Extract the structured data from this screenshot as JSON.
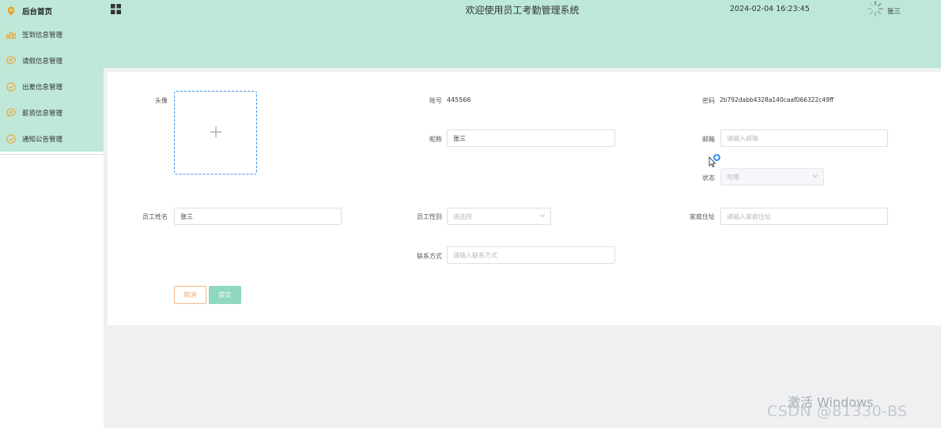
{
  "sidebar": {
    "items": [
      {
        "label": "后台首页",
        "icon": "location-pin-icon"
      },
      {
        "label": "签到信息管理",
        "icon": "bar-chart-icon"
      },
      {
        "label": "请假信息管理",
        "icon": "chat-bubble-icon"
      },
      {
        "label": "出差信息管理",
        "icon": "check-circle-icon"
      },
      {
        "label": "薪资信息管理",
        "icon": "chat-bubble-icon"
      },
      {
        "label": "通知公告管理",
        "icon": "check-circle-icon"
      }
    ],
    "accent_color": "#f0a020"
  },
  "header": {
    "menu_icon": "grid-icon",
    "title": "欢迎使用员工考勤管理系统",
    "datetime": "2024-02-04 16:23:45",
    "user_name": "张三"
  },
  "form": {
    "avatar_label": "头像",
    "account_label": "账号",
    "account_value": "445566",
    "password_label": "密码",
    "password_value": "2b792dabb4328a140caaf066322c49ff",
    "nickname_label": "昵称",
    "nickname_value": "张三",
    "email_label": "邮箱",
    "email_placeholder": "请输入邮箱",
    "status_label": "状态",
    "status_value": "可用",
    "name_label": "员工姓名",
    "name_value": "张三",
    "gender_label": "员工性别",
    "gender_placeholder": "请选择",
    "address_label": "家庭住址",
    "address_placeholder": "请输入家庭住址",
    "contact_label": "联系方式",
    "contact_placeholder": "请输入联系方式",
    "cancel_label": "取消",
    "submit_label": "提交"
  },
  "watermark": {
    "activate": "激活 Windows",
    "csdn": "CSDN @81330-BS"
  }
}
